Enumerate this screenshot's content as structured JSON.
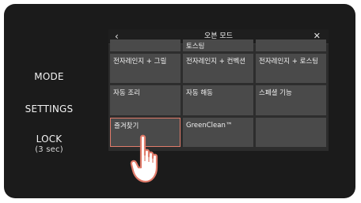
{
  "side_menu": {
    "mode": "MODE",
    "settings": "SETTINGS",
    "lock": "LOCK",
    "lock_sub": "(3 sec)"
  },
  "screen": {
    "title": "오븐 모드",
    "back_icon": "‹",
    "close_icon": "✕",
    "grid": {
      "row0": [
        "",
        "토스팅",
        ""
      ],
      "row1": [
        "전자레인지 + 그릴",
        "전자레인지 + 컨벡션",
        "전자레인지 + 로스팅"
      ],
      "row2": [
        "자동 조리",
        "자동 해동",
        "스페셜 기능"
      ],
      "row3": [
        "즐겨찾기",
        "GreenClean™",
        ""
      ]
    },
    "selected_item": "즐겨찾기"
  },
  "colors": {
    "panel_bg": "#1b1b1b",
    "screen_bg": "#2d2d2d",
    "cell_bg": "#4a4a4a",
    "highlight": "#e07b6a"
  },
  "pointer": "hand-pointer-icon"
}
